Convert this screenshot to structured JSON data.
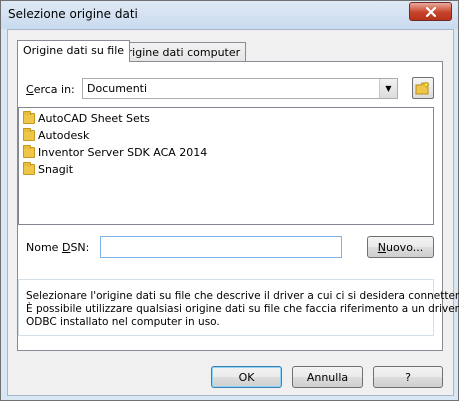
{
  "window": {
    "title": "Selezione origine dati"
  },
  "tabs": [
    {
      "label": "Origine dati su file"
    },
    {
      "label": "Origine dati computer"
    }
  ],
  "lookin": {
    "label_u": "C",
    "label_rest": "erca in:",
    "value": "Documenti"
  },
  "files": [
    {
      "name": "AutoCAD Sheet Sets"
    },
    {
      "name": "Autodesk"
    },
    {
      "name": "Inventor Server SDK ACA 2014"
    },
    {
      "name": "Snagit"
    }
  ],
  "dsn": {
    "label_pre": "Nome ",
    "label_u": "D",
    "label_post": "SN:",
    "value": ""
  },
  "new_button": {
    "label_u": "N",
    "label_rest": "uovo..."
  },
  "description": {
    "line1": "Selezionare l'origine dati su file che descrive il driver a cui ci si desidera connettere.",
    "line2": "È possibile utilizzare qualsiasi origine dati su file che faccia riferimento a un driver",
    "line3": "ODBC installato nel computer in uso."
  },
  "buttons": {
    "ok": "OK",
    "cancel": "Annulla",
    "help": "?"
  },
  "icons": {
    "close": "close-icon",
    "folder": "folder-icon",
    "new_folder": "new-folder-icon",
    "dropdown": "chevron-down-icon"
  }
}
